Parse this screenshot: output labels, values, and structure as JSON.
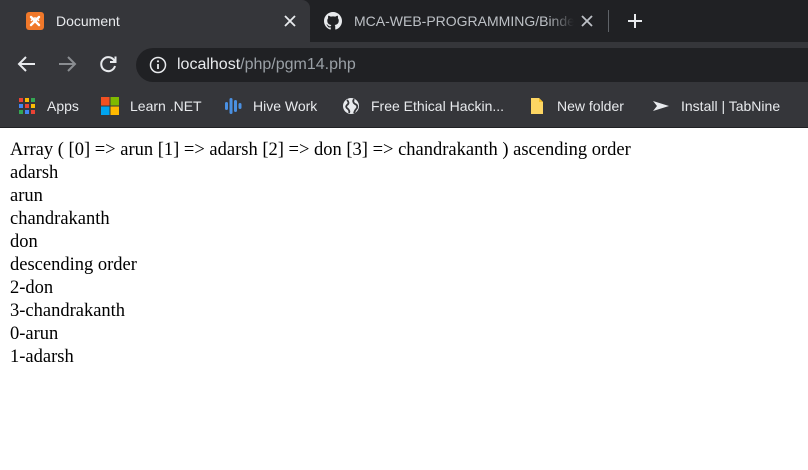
{
  "tabs": [
    {
      "title": "Document",
      "favicon": "xampp-icon",
      "active": true
    },
    {
      "title": "MCA-WEB-PROGRAMMING/Binder",
      "favicon": "github-icon",
      "active": false
    }
  ],
  "address_bar": {
    "host": "localhost",
    "path": "/php/pgm14.php"
  },
  "bookmarks": [
    {
      "label": "Apps",
      "icon": "apps-grid-icon"
    },
    {
      "label": "Learn .NET",
      "icon": "microsoft-logo-icon"
    },
    {
      "label": "Hive Work",
      "icon": "hive-bars-icon"
    },
    {
      "label": "Free Ethical Hackin...",
      "icon": "globe-icon"
    },
    {
      "label": "New folder",
      "icon": "folder-icon"
    },
    {
      "label": "Install | TabNine",
      "icon": "tabnine-arrow-icon"
    }
  ],
  "page": {
    "lines": [
      "Array ( [0] => arun [1] => adarsh [2] => don [3] => chandrakanth ) ascending order",
      "adarsh",
      "arun",
      "chandrakanth",
      "don",
      "descending order",
      "2-don",
      "3-chandrakanth",
      "0-arun",
      "1-adarsh"
    ]
  },
  "colors": {
    "chrome_dark": "#202124",
    "chrome_toolbar": "#35363a",
    "xampp_orange": "#f0782a",
    "text_light": "#e8eaed"
  }
}
